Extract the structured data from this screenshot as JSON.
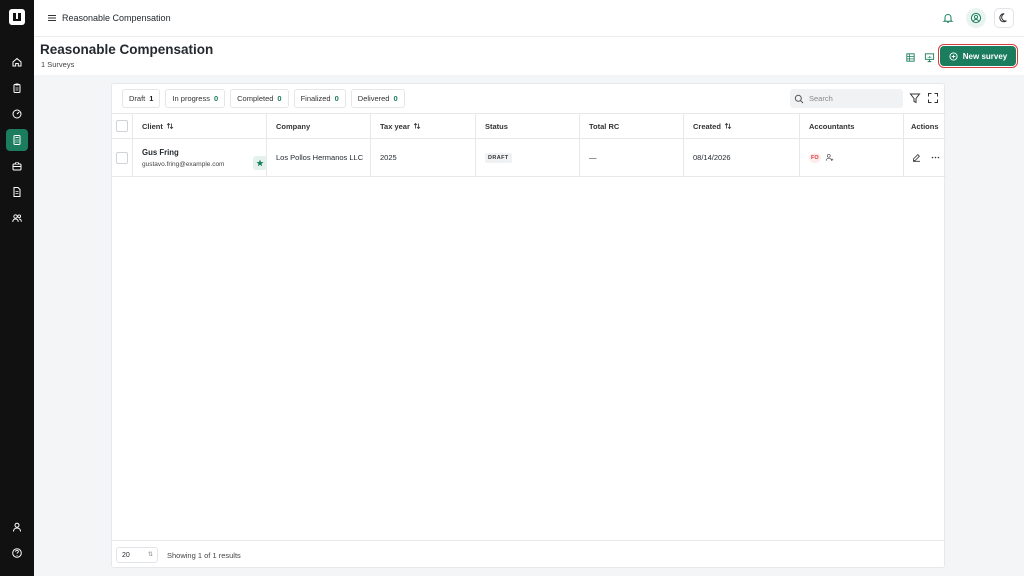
{
  "app": {
    "title": "Reasonable Compensation"
  },
  "page": {
    "title": "Reasonable Compensation",
    "subtitle": "1 Surveys"
  },
  "sidebar": {
    "items": [
      {
        "name": "home",
        "icon": "home-icon",
        "active": false
      },
      {
        "name": "clipboard",
        "icon": "clipboard-icon",
        "active": false
      },
      {
        "name": "gauge",
        "icon": "gauge-icon",
        "active": false
      },
      {
        "name": "surveys",
        "icon": "calculator-icon",
        "active": true
      },
      {
        "name": "briefcase",
        "icon": "briefcase-icon",
        "active": false
      },
      {
        "name": "document",
        "icon": "document-icon",
        "active": false
      },
      {
        "name": "users",
        "icon": "users-icon",
        "active": false
      }
    ],
    "bottom": [
      {
        "name": "profile",
        "icon": "user-icon"
      },
      {
        "name": "help",
        "icon": "help-icon"
      }
    ]
  },
  "toolbar": {
    "new_survey_label": "New survey"
  },
  "tabs": [
    {
      "label": "Draft",
      "count": "1"
    },
    {
      "label": "In progress",
      "count": "0"
    },
    {
      "label": "Completed",
      "count": "0"
    },
    {
      "label": "Finalized",
      "count": "0"
    },
    {
      "label": "Delivered",
      "count": "0"
    }
  ],
  "search": {
    "placeholder": "Search"
  },
  "table": {
    "columns": [
      "Client",
      "Company",
      "Tax year",
      "Status",
      "Total RC",
      "Created",
      "Accountants",
      "Actions"
    ],
    "rows": [
      {
        "client_name": "Gus Fring",
        "client_email": "gustavo.fring@example.com",
        "company": "Los Pollos Hermanos LLC",
        "tax_year": "2025",
        "status": "DRAFT",
        "total_rc": "—",
        "created": "08/14/2026",
        "accountant_initials": "FO"
      }
    ]
  },
  "footer": {
    "page_size": "20",
    "showing": "Showing 1 of 1 results"
  },
  "colors": {
    "accent": "#1b7c5e",
    "highlight": "#d93b3b",
    "sidebar_bg": "#111111"
  }
}
